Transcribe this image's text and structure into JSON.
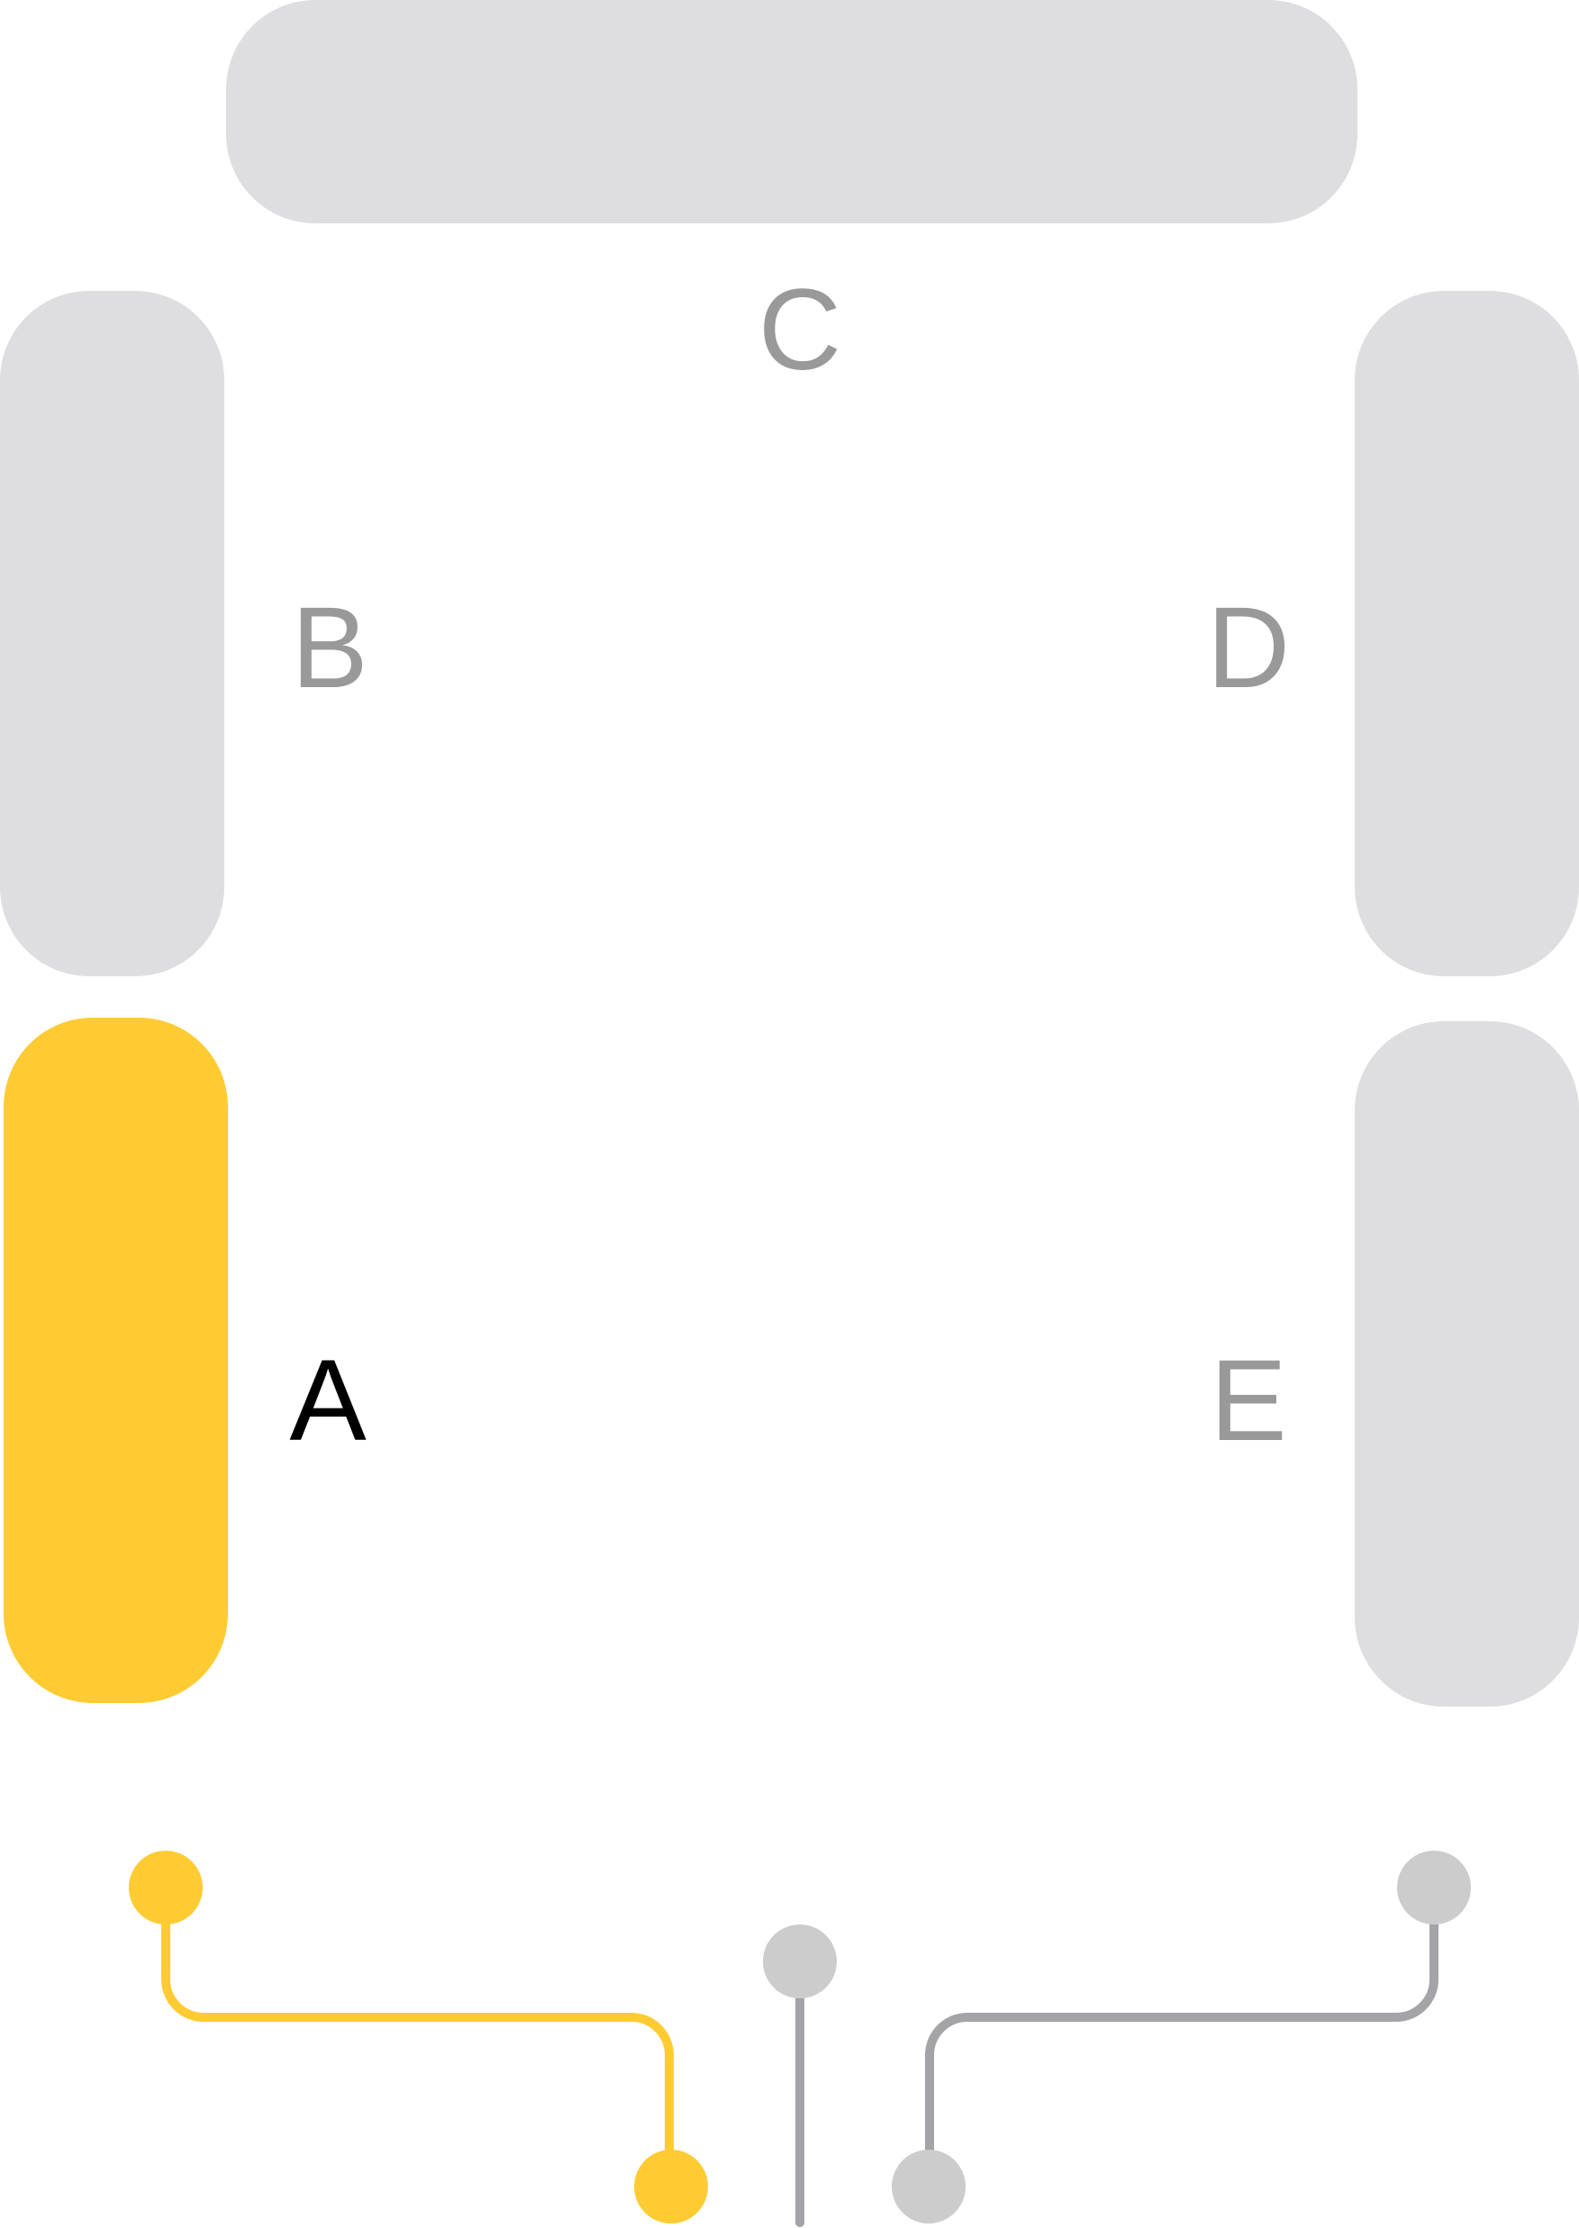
{
  "segments": {
    "a": {
      "label": "A",
      "active": true
    },
    "b": {
      "label": "B",
      "active": false
    },
    "c": {
      "label": "C",
      "active": false
    },
    "d": {
      "label": "D",
      "active": false
    },
    "e": {
      "label": "E",
      "active": false
    }
  },
  "colors": {
    "active_fill": "#FFCB33",
    "inactive_fill": "#DEDEE0",
    "active_label": "#000000",
    "inactive_label": "#999999",
    "active_line": "#FFCB33",
    "inactive_line": "#A3A3A8",
    "inactive_dot": "#CCCCCC"
  },
  "connectors": {
    "a": {
      "active": true
    },
    "center": {
      "active": false
    },
    "e": {
      "active": false
    }
  }
}
